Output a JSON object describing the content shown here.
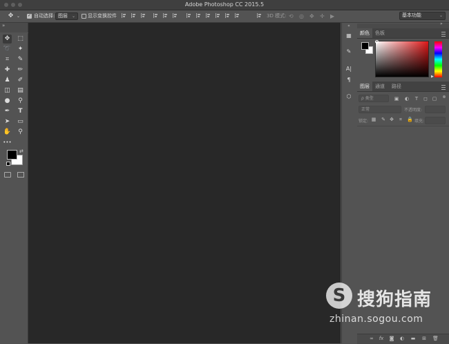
{
  "window": {
    "title": "Adobe Photoshop CC 2015.5"
  },
  "options_bar": {
    "auto_select_label": "自动选择:",
    "auto_select_target": "图层",
    "show_transform_label": "显示变换控件",
    "mode_3d_label": "3D 模式:",
    "workspace": "基本功能"
  },
  "color_panel": {
    "tabs": [
      "颜色",
      "色板"
    ],
    "fg_color": "#000000",
    "bg_color": "#ffffff"
  },
  "layers_panel": {
    "tabs": [
      "图层",
      "通道",
      "路径"
    ],
    "filter_kind": "ρ 类型",
    "blend_mode": "正常",
    "opacity_label": "不透明度:",
    "lock_label": "锁定:",
    "fill_label": "填充:"
  },
  "watermark": {
    "title": "搜狗指南",
    "url": "zhinan.sogou.com",
    "logo_letter": "S"
  },
  "icons": {
    "move": "✥",
    "marquee": "⬚",
    "lasso": "➰",
    "magic_wand": "✦",
    "crop": "⌗",
    "eyedropper": "✎",
    "healing": "✚",
    "brush": "✏",
    "stamp": "♟",
    "history_brush": "✐",
    "eraser": "◫",
    "gradient": "▤",
    "blur": "●",
    "dodge": "⚲",
    "pen": "✒",
    "type": "T",
    "path_select": "➤",
    "rectangle": "▭",
    "hand": "✋",
    "zoom": "⚲",
    "more": "•••"
  },
  "colors": {
    "canvas": "#282828",
    "ui": "#535353",
    "titlebar": "#3f3f3f"
  }
}
